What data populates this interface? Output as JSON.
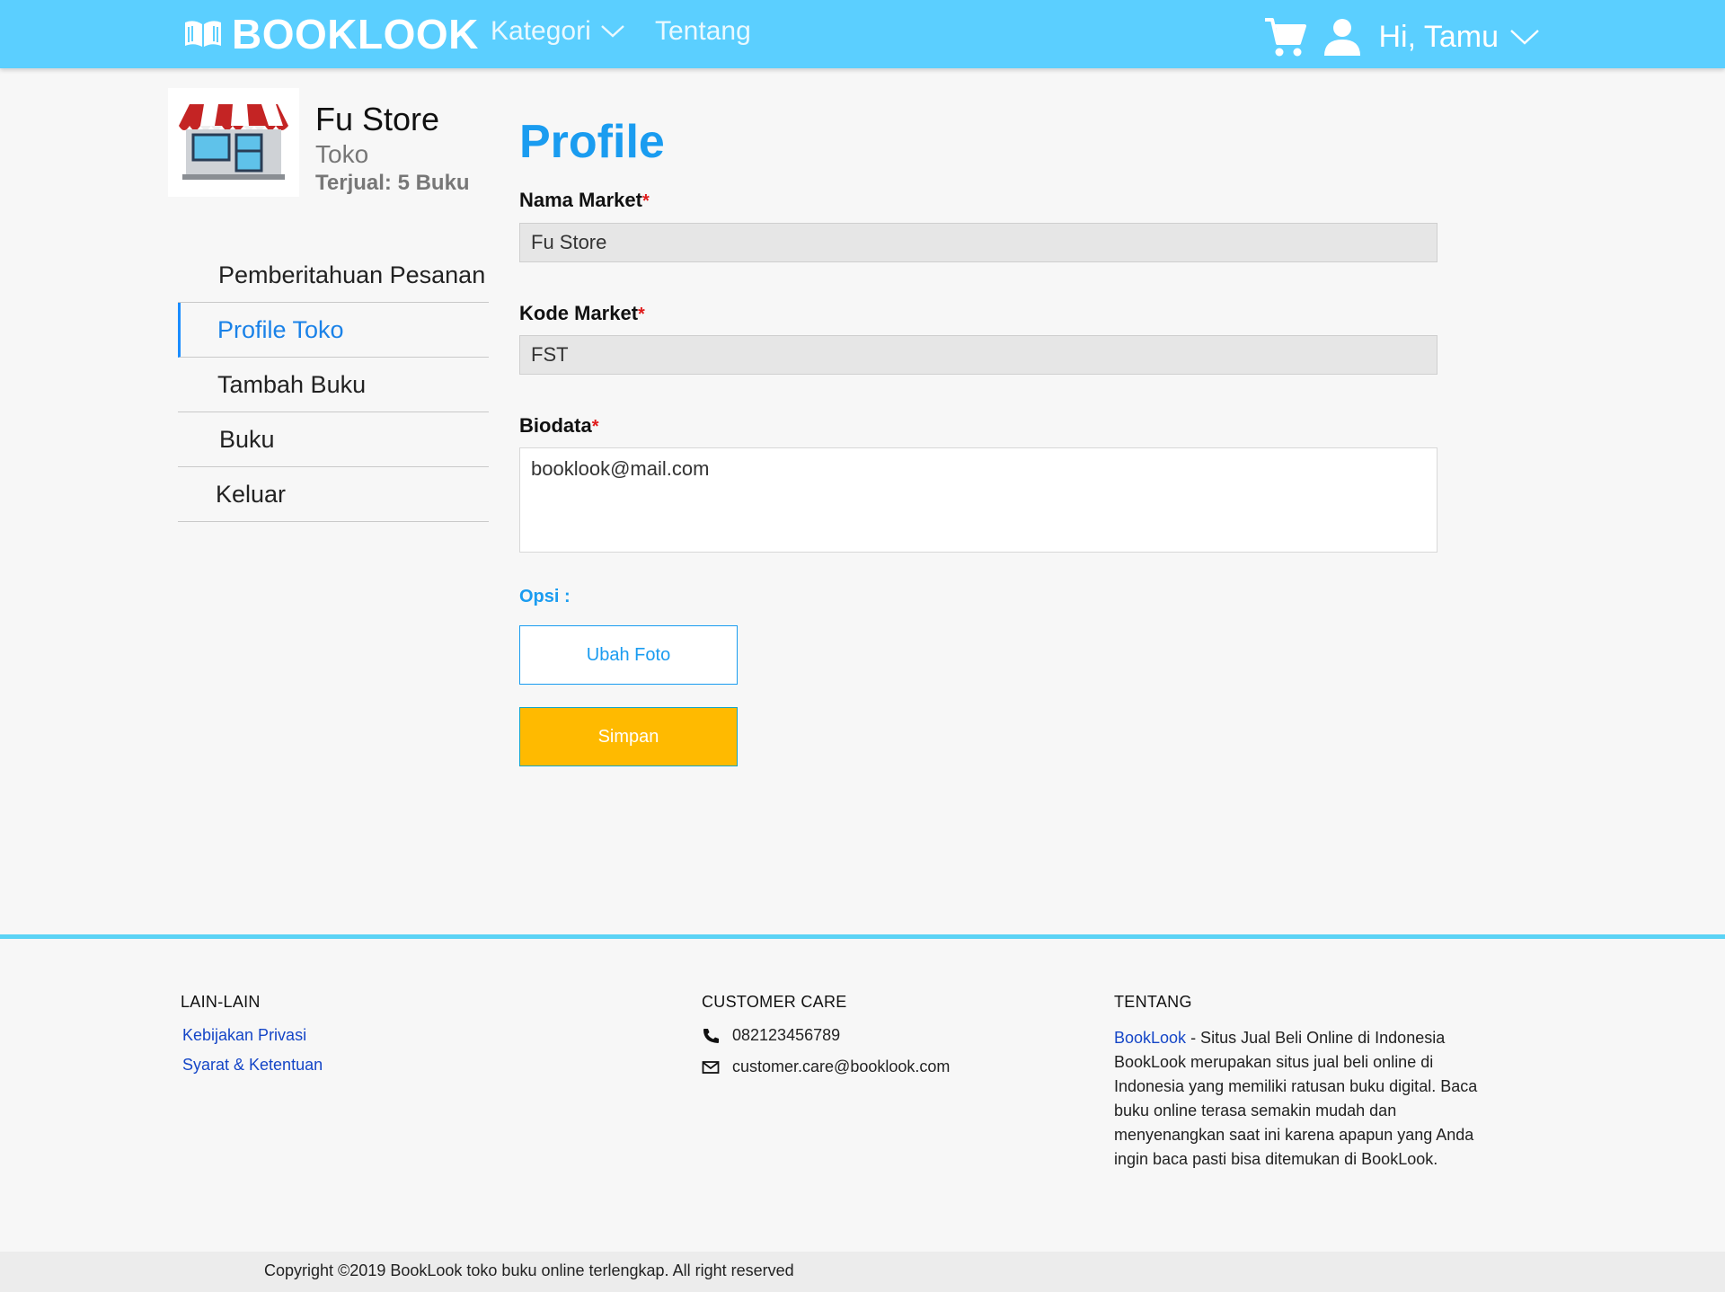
{
  "navbar": {
    "brand": "BOOKLOOK",
    "kategori": "Kategori",
    "tentang": "Tentang",
    "greeting": "Hi, Tamu",
    "bg_color": "#5bcfff"
  },
  "store": {
    "name": "Fu Store",
    "type": "Toko",
    "sold": "Terjual: 5 Buku",
    "avatar_icon": "storefront-icon"
  },
  "sidebar": {
    "items": [
      {
        "label": "Pemberitahuan Pesanan",
        "active": false
      },
      {
        "label": "Profile Toko",
        "active": true
      },
      {
        "label": "Tambah Buku",
        "active": false
      },
      {
        "label": "Buku",
        "active": false
      },
      {
        "label": "Keluar",
        "active": false
      }
    ]
  },
  "form": {
    "title": "Profile",
    "required_mark": "*",
    "nama_market_label": "Nama Market",
    "nama_market_value": "Fu Store",
    "kode_market_label": "Kode Market",
    "kode_market_value": "FST",
    "biodata_label": "Biodata",
    "biodata_value": "booklook@mail.com",
    "opsi_label": "Opsi :",
    "ubah_foto": "Ubah Foto",
    "simpan": "Simpan",
    "accent_color": "#1a9cf0",
    "simpan_color": "#ffba00"
  },
  "footer": {
    "lain_heading": "LAIN-LAIN",
    "links": [
      "Kebijakan Privasi",
      "Syarat & Ketentuan"
    ],
    "care_heading": "CUSTOMER CARE",
    "phone": "082123456789",
    "email": "customer.care@booklook.com",
    "tentang_heading": "TENTANG",
    "about_brand": "BookLook",
    "about_tagline": " - Situs Jual Beli Online di Indonesia",
    "about_body": "BookLook merupakan situs jual beli online di Indonesia yang memiliki ratusan buku digital. Baca buku online terasa semakin mudah dan menyenangkan saat ini karena apapun yang Anda ingin baca pasti bisa ditemukan di BookLook.",
    "copyright": "Copyright ©2019 BookLook toko buku online terlengkap. All right reserved"
  }
}
